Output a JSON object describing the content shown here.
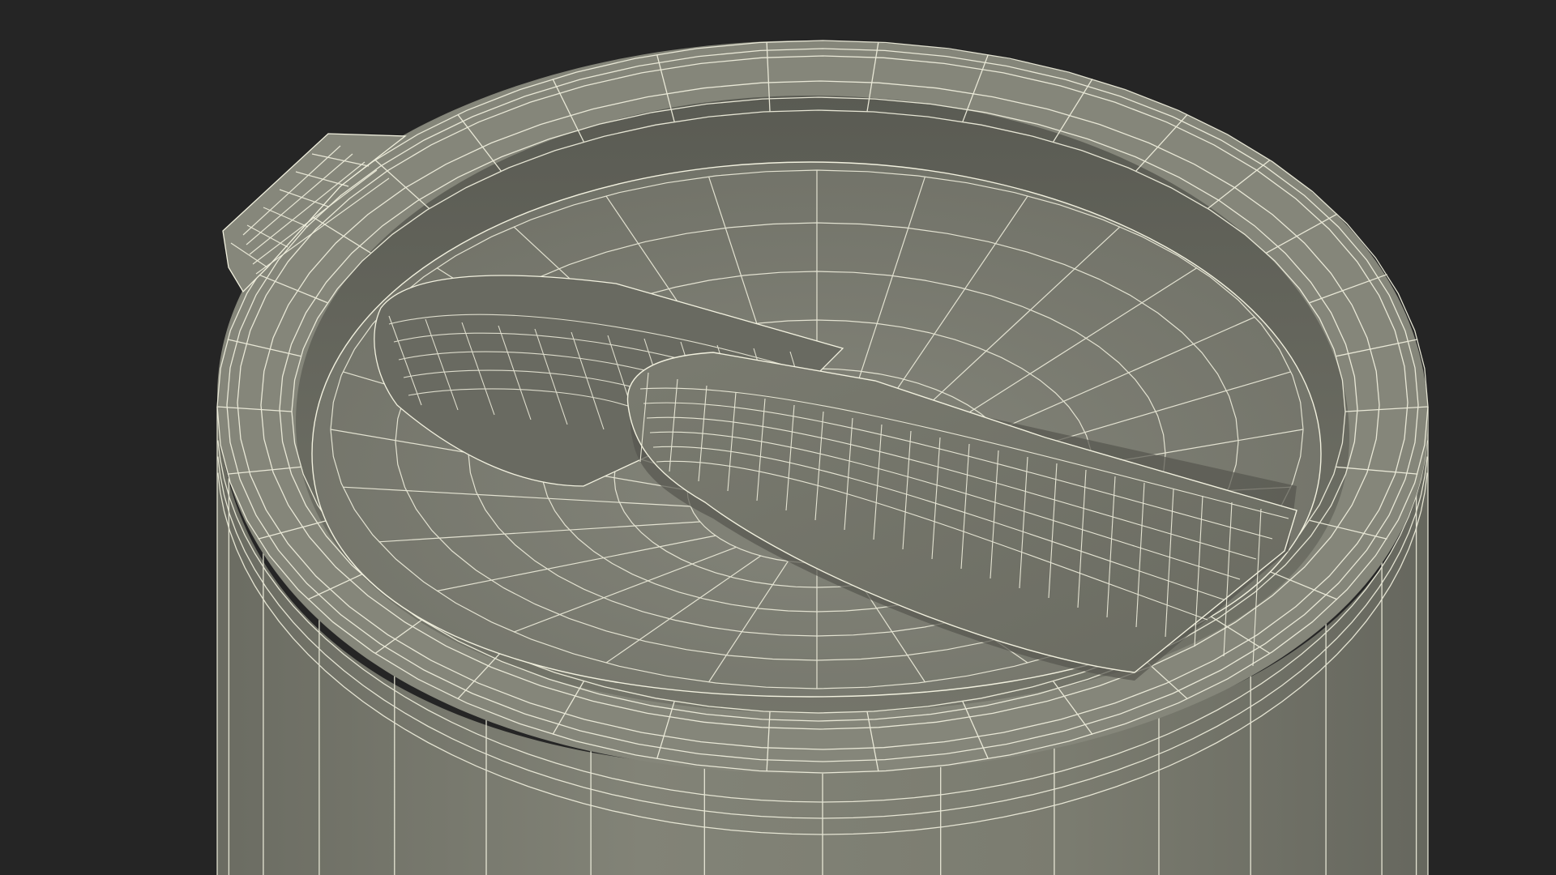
{
  "scene": {
    "subject": "wireframe-tumbler-lid",
    "background_color": "#252525",
    "surface_color": "#7d7e72",
    "surface_shadow_color": "#5e5f56",
    "surface_light_color": "#8a8b7f",
    "wire_color": "#f2f1df",
    "view": "perspective-top"
  }
}
